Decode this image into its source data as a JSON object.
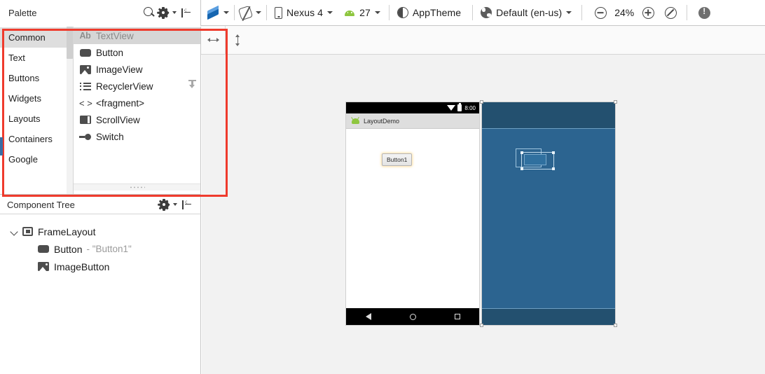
{
  "toolbar": {
    "palette_title": "Palette",
    "search_icon": "search-icon",
    "gear_icon": "gear-icon",
    "collapse_icon": "collapse-panel-icon",
    "layers_icon": "design-mode-layers-icon",
    "orientation_icon": "orientation-rotate-icon",
    "device_icon": "phone-device-icon",
    "device_label": "Nexus 4",
    "api_icon": "android-api-icon",
    "api_label": "27",
    "theme_icon": "theme-contrast-icon",
    "theme_label": "AppTheme",
    "locale_icon": "globe-locale-icon",
    "locale_label": "Default (en-us)",
    "zoom_out_icon": "zoom-out-icon",
    "zoom_label": "24%",
    "zoom_in_icon": "zoom-in-icon",
    "zoom_fit_icon": "zoom-fit-icon",
    "warning_icon": "warning-info-icon"
  },
  "strip": {
    "resize_horizontal_icon": "resize-horizontal-icon",
    "resize_vertical_icon": "resize-vertical-icon"
  },
  "palette": {
    "categories": [
      {
        "label": "Common",
        "selected": true
      },
      {
        "label": "Text",
        "selected": false
      },
      {
        "label": "Buttons",
        "selected": false
      },
      {
        "label": "Widgets",
        "selected": false
      },
      {
        "label": "Layouts",
        "selected": false
      },
      {
        "label": "Containers",
        "selected": false
      },
      {
        "label": "Google",
        "selected": false
      }
    ],
    "items": [
      {
        "label": "TextView",
        "icon": "textview-icon",
        "selected": true,
        "download": false
      },
      {
        "label": "Button",
        "icon": "button-icon",
        "selected": false,
        "download": false
      },
      {
        "label": "ImageView",
        "icon": "imageview-icon",
        "selected": false,
        "download": false
      },
      {
        "label": "RecyclerView",
        "icon": "recyclerview-icon",
        "selected": false,
        "download": true
      },
      {
        "label": "<fragment>",
        "icon": "fragment-icon",
        "selected": false,
        "download": false
      },
      {
        "label": "ScrollView",
        "icon": "scrollview-icon",
        "selected": false,
        "download": false
      },
      {
        "label": "Switch",
        "icon": "switch-icon",
        "selected": false,
        "download": false
      }
    ]
  },
  "component_tree": {
    "title": "Component Tree",
    "gear_icon": "gear-icon",
    "collapse_icon": "collapse-panel-icon",
    "nodes": [
      {
        "label": "FrameLayout",
        "value": "",
        "icon": "framelayout-icon",
        "level": 0,
        "expanded": true
      },
      {
        "label": "Button",
        "value": "- \"Button1\"",
        "icon": "button-icon",
        "level": 1,
        "expanded": false
      },
      {
        "label": "ImageButton",
        "value": "",
        "icon": "imagebutton-icon",
        "level": 1,
        "expanded": false
      }
    ]
  },
  "preview": {
    "status_time": "8:00",
    "app_title": "LayoutDemo",
    "button_label": "Button1",
    "nav_back_icon": "nav-back-icon",
    "nav_home_icon": "nav-home-icon",
    "nav_recents_icon": "nav-recents-icon",
    "wifi_icon": "wifi-icon",
    "battery_icon": "battery-icon",
    "app_icon": "android-robot-icon"
  },
  "colors": {
    "highlight": "#ef3b2d",
    "blueprint_body": "#2c6490",
    "blueprint_bar": "#23506f",
    "accent_blue": "#2d7dd2",
    "android_green": "#8ec63f"
  }
}
